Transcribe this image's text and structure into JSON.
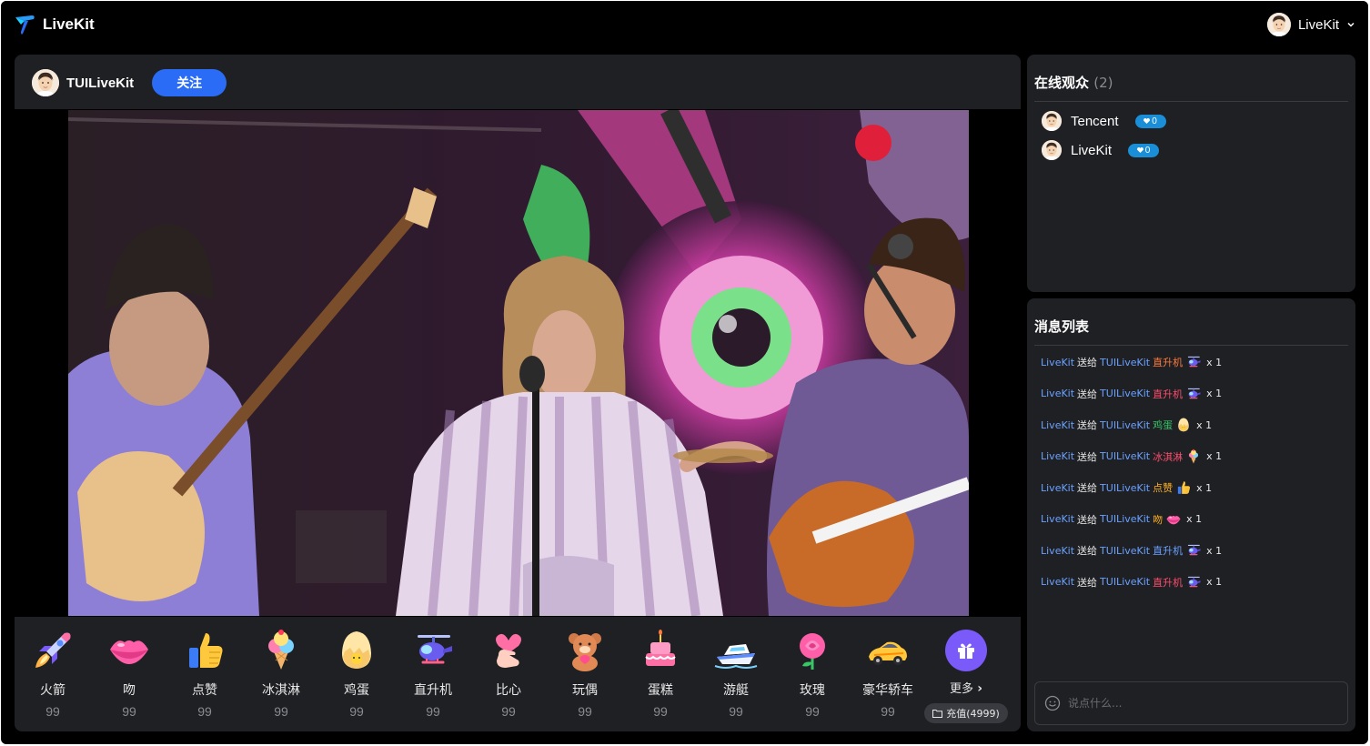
{
  "app": {
    "brand": "LiveKit",
    "accent": "#2a6cf6"
  },
  "header": {
    "user_name": "LiveKit"
  },
  "stage": {
    "anchor_name": "TUILiveKit",
    "follow_label": "关注"
  },
  "gifts": [
    {
      "name": "火箭",
      "price": "99",
      "icon": "rocket-icon"
    },
    {
      "name": "吻",
      "price": "99",
      "icon": "lips-icon"
    },
    {
      "name": "点赞",
      "price": "99",
      "icon": "thumbs-up-icon"
    },
    {
      "name": "冰淇淋",
      "price": "99",
      "icon": "ice-cream-icon"
    },
    {
      "name": "鸡蛋",
      "price": "99",
      "icon": "egg-icon"
    },
    {
      "name": "直升机",
      "price": "99",
      "icon": "helicopter-icon"
    },
    {
      "name": "比心",
      "price": "99",
      "icon": "finger-heart-icon"
    },
    {
      "name": "玩偶",
      "price": "99",
      "icon": "teddy-bear-icon"
    },
    {
      "name": "蛋糕",
      "price": "99",
      "icon": "cake-icon"
    },
    {
      "name": "游艇",
      "price": "99",
      "icon": "yacht-icon"
    },
    {
      "name": "玫瑰",
      "price": "99",
      "icon": "rose-icon"
    },
    {
      "name": "豪华轿车",
      "price": "99",
      "icon": "sports-car-icon"
    }
  ],
  "gift_more": {
    "label": "更多",
    "recharge_label": "充值(4999)"
  },
  "audience": {
    "title": "在线观众",
    "count": "(2)",
    "users": [
      {
        "name": "Tencent",
        "level": "0"
      },
      {
        "name": "LiveKit",
        "level": "0"
      }
    ]
  },
  "messages": {
    "title": "消息列表",
    "send_verb": "送给",
    "items": [
      {
        "from": "LiveKit",
        "to": "TUILiveKit",
        "gift": "直升机",
        "gift_color": "#ff7a3d",
        "icon": "helicopter-icon",
        "qty": "x 1"
      },
      {
        "from": "LiveKit",
        "to": "TUILiveKit",
        "gift": "直升机",
        "gift_color": "#ff4d6d",
        "icon": "helicopter-icon",
        "qty": "x 1"
      },
      {
        "from": "LiveKit",
        "to": "TUILiveKit",
        "gift": "鸡蛋",
        "gift_color": "#3ac569",
        "icon": "egg-icon",
        "qty": "x 1"
      },
      {
        "from": "LiveKit",
        "to": "TUILiveKit",
        "gift": "冰淇淋",
        "gift_color": "#ff4d6d",
        "icon": "ice-cream-icon",
        "qty": "x 1"
      },
      {
        "from": "LiveKit",
        "to": "TUILiveKit",
        "gift": "点赞",
        "gift_color": "#ffb020",
        "icon": "thumbs-up-icon",
        "qty": "x 1"
      },
      {
        "from": "LiveKit",
        "to": "TUILiveKit",
        "gift": "吻",
        "gift_color": "#ffb020",
        "icon": "lips-icon",
        "qty": "x 1"
      },
      {
        "from": "LiveKit",
        "to": "TUILiveKit",
        "gift": "直升机",
        "gift_color": "#6aa1ff",
        "icon": "helicopter-icon",
        "qty": "x 1"
      },
      {
        "from": "LiveKit",
        "to": "TUILiveKit",
        "gift": "直升机",
        "gift_color": "#ff4d6d",
        "icon": "helicopter-icon",
        "qty": "x 1"
      }
    ]
  },
  "chat": {
    "placeholder": "说点什么..."
  }
}
